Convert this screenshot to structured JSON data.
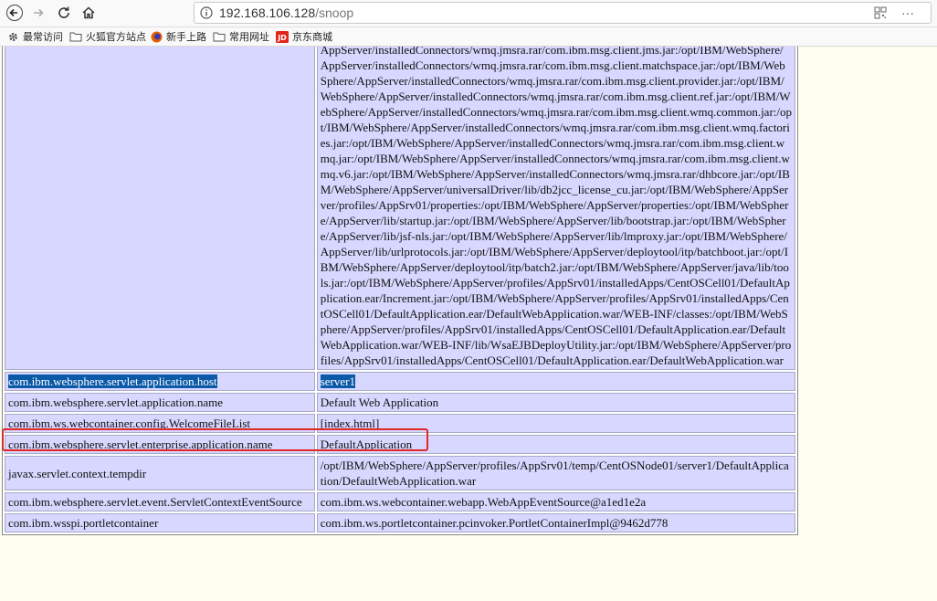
{
  "browser": {
    "url_host": "192.168.106.128",
    "url_path": "/snoop",
    "bookmarks": [
      {
        "label": "最常访问",
        "icon": "gear-icon"
      },
      {
        "label": "火狐官方站点",
        "icon": "folder-icon"
      },
      {
        "label": "新手上路",
        "icon": "firefox-icon"
      },
      {
        "label": "常用网址",
        "icon": "folder-icon"
      },
      {
        "label": "京东商城",
        "icon": "jd-icon"
      }
    ],
    "menu_glyph": "···"
  },
  "classpath_text": "AppServer/installedConnectors/wmq.jmsra.rar/com.ibm.msg.client.jms.jar:/opt/IBM/WebSphere/AppServer/installedConnectors/wmq.jmsra.rar/com.ibm.msg.client.matchspace.jar:/opt/IBM/WebSphere/AppServer/installedConnectors/wmq.jmsra.rar/com.ibm.msg.client.provider.jar:/opt/IBM/WebSphere/AppServer/installedConnectors/wmq.jmsra.rar/com.ibm.msg.client.ref.jar:/opt/IBM/WebSphere/AppServer/installedConnectors/wmq.jmsra.rar/com.ibm.msg.client.wmq.common.jar:/opt/IBM/WebSphere/AppServer/installedConnectors/wmq.jmsra.rar/com.ibm.msg.client.wmq.factories.jar:/opt/IBM/WebSphere/AppServer/installedConnectors/wmq.jmsra.rar/com.ibm.msg.client.wmq.jar:/opt/IBM/WebSphere/AppServer/installedConnectors/wmq.jmsra.rar/com.ibm.msg.client.wmq.v6.jar:/opt/IBM/WebSphere/AppServer/installedConnectors/wmq.jmsra.rar/dhbcore.jar:/opt/IBM/WebSphere/AppServer/universalDriver/lib/db2jcc_license_cu.jar:/opt/IBM/WebSphere/AppServer/profiles/AppSrv01/properties:/opt/IBM/WebSphere/AppServer/properties:/opt/IBM/WebSphere/AppServer/lib/startup.jar:/opt/IBM/WebSphere/AppServer/lib/bootstrap.jar:/opt/IBM/WebSphere/AppServer/lib/jsf-nls.jar:/opt/IBM/WebSphere/AppServer/lib/lmproxy.jar:/opt/IBM/WebSphere/AppServer/lib/urlprotocols.jar:/opt/IBM/WebSphere/AppServer/deploytool/itp/batchboot.jar:/opt/IBM/WebSphere/AppServer/deploytool/itp/batch2.jar:/opt/IBM/WebSphere/AppServer/java/lib/tools.jar:/opt/IBM/WebSphere/AppServer/profiles/AppSrv01/installedApps/CentOSCell01/DefaultApplication.ear/Increment.jar:/opt/IBM/WebSphere/AppServer/profiles/AppSrv01/installedApps/CentOSCell01/DefaultApplication.ear/DefaultWebApplication.war/WEB-INF/classes:/opt/IBM/WebSphere/AppServer/profiles/AppSrv01/installedApps/CentOSCell01/DefaultApplication.ear/DefaultWebApplication.war/WEB-INF/lib/WsaEJBDeployUtility.jar:/opt/IBM/WebSphere/AppServer/profiles/AppSrv01/installedApps/CentOSCell01/DefaultApplication.ear/DefaultWebApplication.war",
  "rows": [
    {
      "key": "com.ibm.websphere.servlet.application.host",
      "value": "server1"
    },
    {
      "key": "com.ibm.websphere.servlet.application.name",
      "value": "Default Web Application"
    },
    {
      "key": "com.ibm.ws.webcontainer.config.WelcomeFileList",
      "value": "[index.html]"
    },
    {
      "key": "com.ibm.websphere.servlet.enterprise.application.name",
      "value": "DefaultApplication"
    },
    {
      "key": "javax.servlet.context.tempdir",
      "value": "/opt/IBM/WebSphere/AppServer/profiles/AppSrv01/temp/CentOSNode01/server1/DefaultApplication/DefaultWebApplication.war"
    },
    {
      "key": "com.ibm.websphere.servlet.event.ServletContextEventSource",
      "value": "com.ibm.ws.webcontainer.webapp.WebAppEventSource@a1ed1e2a"
    },
    {
      "key": "com.ibm.wsspi.portletcontainer",
      "value": "com.ibm.ws.portletcontainer.pcinvoker.PortletContainerImpl@9462d778"
    }
  ],
  "colors": {
    "highlight_border": "#e02828",
    "selection": "#0b5aa8",
    "cell_bg": "#d7d7ff"
  }
}
